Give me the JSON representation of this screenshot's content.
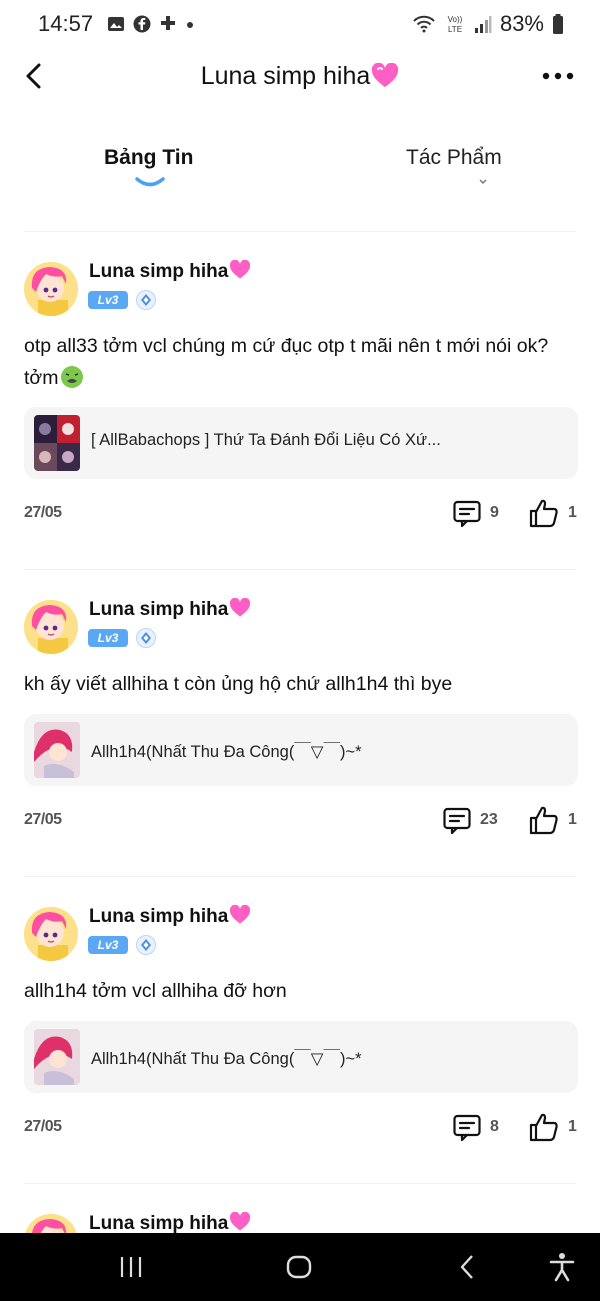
{
  "status_bar": {
    "time": "14:57",
    "battery": "83%",
    "icons": [
      "gallery-icon",
      "facebook-icon",
      "game-controller-icon",
      "dot-icon",
      "wifi-icon",
      "volte-icon",
      "signal-icon",
      "battery-icon"
    ]
  },
  "header": {
    "title": "Luna simp hiha",
    "back_icon": "chevron-left-icon",
    "more_icon": "more-dots-icon"
  },
  "tabs": [
    {
      "label": "Bảng Tin",
      "active": true
    },
    {
      "label": "Tác Phẩm",
      "active": false
    }
  ],
  "posts": [
    {
      "author": "Luna simp hiha",
      "level": "Lv3",
      "text": "otp all33 tởm vcl chúng m cứ đục otp t mãi nên t mới nói ok? tởm",
      "ref_title": "[ AllBabachops ] Thứ Ta Đánh Đổi Liệu Có Xứ...",
      "date": "27/05",
      "comments": "9",
      "likes": "1"
    },
    {
      "author": "Luna simp hiha",
      "level": "Lv3",
      "text": "kh ấy viết allhiha t còn ủng hộ chứ allh1h4 thì bye",
      "ref_title": "Allh1h4(Nhất Thu Đa Công(￣▽￣)~*",
      "date": "27/05",
      "comments": "23",
      "likes": "1"
    },
    {
      "author": "Luna simp hiha",
      "level": "Lv3",
      "text": "allh1h4 tởm vcl allhiha đỡ hơn",
      "ref_title": "Allh1h4(Nhất Thu Đa Công(￣▽￣)~*",
      "date": "27/05",
      "comments": "8",
      "likes": "1"
    },
    {
      "author": "Luna simp hiha"
    }
  ],
  "colors": {
    "accent_blue": "#4aa3f0",
    "heart_pink": "#ff5ec4",
    "level_badge": "#5aa8f3",
    "card_bg": "#f5f5f5"
  }
}
